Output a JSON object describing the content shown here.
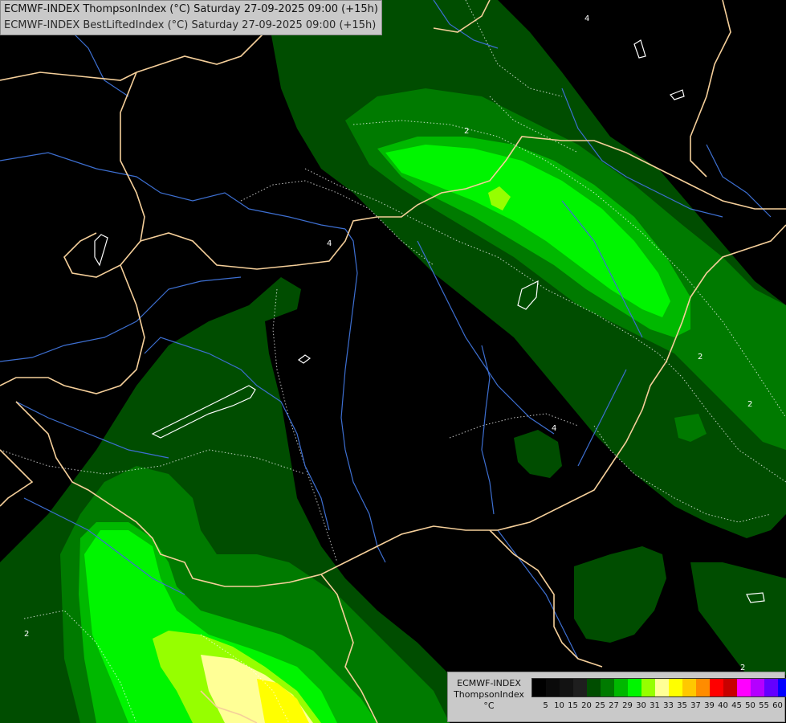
{
  "title": {
    "line1": "ECMWF-INDEX ThompsonIndex (°C) Saturday 27-09-2025 09:00 (+15h)",
    "line2": "ECMWF-INDEX BestLiftedIndex (°C) Saturday 27-09-2025 09:00 (+15h)"
  },
  "legend": {
    "line1": "ECMWF-INDEX",
    "line2": "ThompsonIndex",
    "unit": "°C",
    "ticks": [
      "5",
      "10",
      "15",
      "20",
      "25",
      "27",
      "29",
      "30",
      "31",
      "33",
      "35",
      "37",
      "39",
      "40",
      "45",
      "50",
      "55",
      "60"
    ],
    "colors": [
      "#000000",
      "#0a0a0a",
      "#121212",
      "#1e1e1e",
      "#004d00",
      "#007a00",
      "#00b800",
      "#00f500",
      "#96ff00",
      "#ffff96",
      "#ffff00",
      "#ffc800",
      "#ff8c00",
      "#ff0000",
      "#c80000",
      "#ff00ff",
      "#b400ff",
      "#6400ff",
      "#0000ff"
    ]
  },
  "contour_labels": [
    "2",
    "2",
    "4",
    "2",
    "2",
    "4",
    "4",
    "2"
  ],
  "colors": {
    "shade_dark": "#004d00",
    "shade_mid": "#007a00",
    "shade_green": "#00b800",
    "shade_bright": "#00f500",
    "shade_lime": "#96ff00",
    "shade_paleyellow": "#ffff96",
    "shade_yellow": "#ffff00",
    "border": "#f5cf9a",
    "river": "#3d6fd1",
    "contour": "#ffffff"
  }
}
